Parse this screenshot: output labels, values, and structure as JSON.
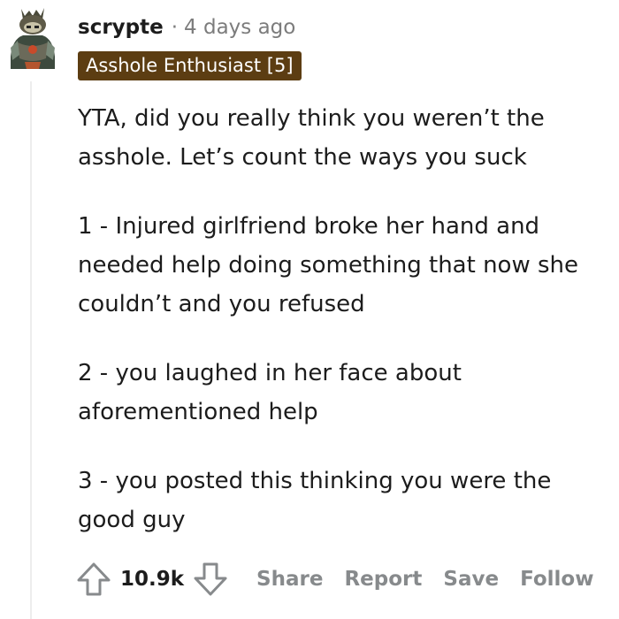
{
  "comment": {
    "username": "scrypte",
    "separator": "·",
    "timestamp": "4 days ago",
    "flair": "Asshole Enthusiast [5]",
    "paragraphs": [
      "YTA, did you really think you weren’t the asshole. Let’s count the ways you suck",
      "1 - Injured girlfriend broke her hand and needed help doing something that now she couldn’t and you refused",
      "2 - you laughed in her face about aforementioned help",
      "3 - you posted this thinking you were the good guy"
    ],
    "score": "10.9k",
    "actions": {
      "share": "Share",
      "report": "Report",
      "save": "Save",
      "follow": "Follow"
    }
  },
  "colors": {
    "flair_bg": "#5c3d12",
    "meta_text": "#7c7c7c",
    "action_text": "#878a8c",
    "thread_line": "#ededed"
  },
  "icons": {
    "upvote": "upvote-arrow-icon",
    "downvote": "downvote-arrow-icon",
    "avatar": "user-avatar"
  }
}
